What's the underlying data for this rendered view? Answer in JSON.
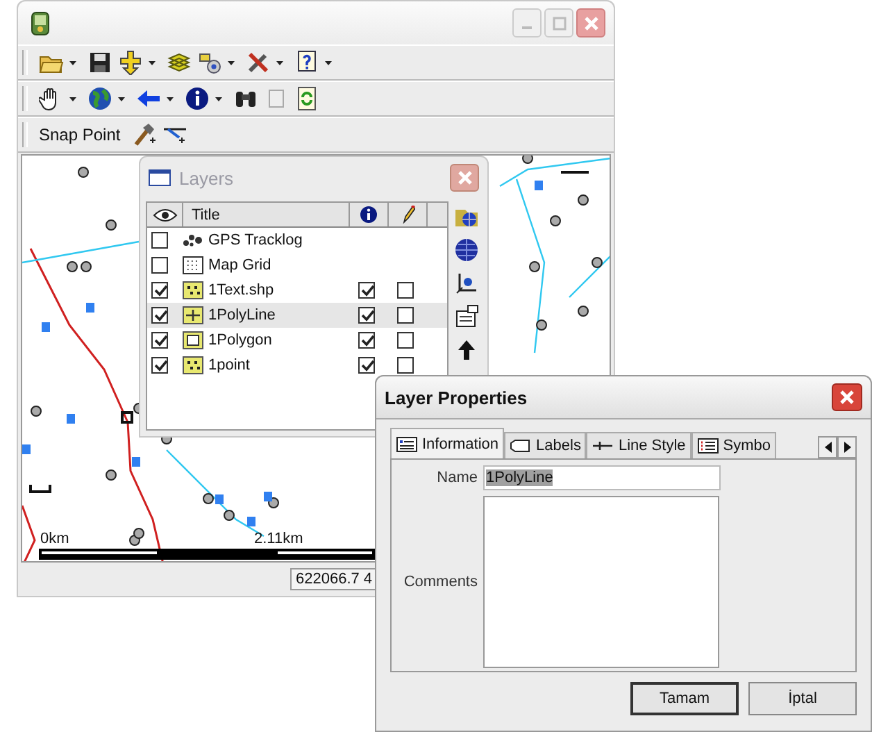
{
  "main_window": {
    "snap_toolbar": {
      "label": "Snap Point"
    },
    "map": {
      "scale_labels": [
        "0km",
        "2.11km"
      ]
    },
    "status_bar": {
      "coordinates": "622066.7 4"
    }
  },
  "layers_window": {
    "title": "Layers",
    "columns": [
      "Title"
    ],
    "layers": [
      {
        "name": "GPS Tracklog",
        "kind": "tracklog",
        "visible": false,
        "selected": false
      },
      {
        "name": "Map Grid",
        "kind": "grid",
        "visible": false,
        "selected": false
      },
      {
        "name": "1Text.shp",
        "kind": "points",
        "visible": true,
        "info": true,
        "editable": false,
        "selected": false
      },
      {
        "name": "1PolyLine",
        "kind": "line",
        "visible": true,
        "info": true,
        "editable": false,
        "selected": true
      },
      {
        "name": "1Polygon",
        "kind": "polygon",
        "visible": true,
        "info": true,
        "editable": false,
        "selected": false
      },
      {
        "name": "1point",
        "kind": "points",
        "visible": true,
        "info": true,
        "editable": false,
        "selected": false
      }
    ]
  },
  "layer_properties": {
    "title": "Layer Properties",
    "tabs": [
      {
        "label": "Information",
        "kind": "info",
        "selected": true
      },
      {
        "label": "Labels",
        "kind": "label",
        "selected": false
      },
      {
        "label": "Line Style",
        "kind": "line",
        "selected": false
      },
      {
        "label": "Symbo",
        "kind": "list",
        "selected": false
      }
    ],
    "name_label": "Name",
    "name_value": "1PolyLine",
    "comments_label": "Comments",
    "buttons": [
      "Tamam",
      "İptal"
    ]
  }
}
